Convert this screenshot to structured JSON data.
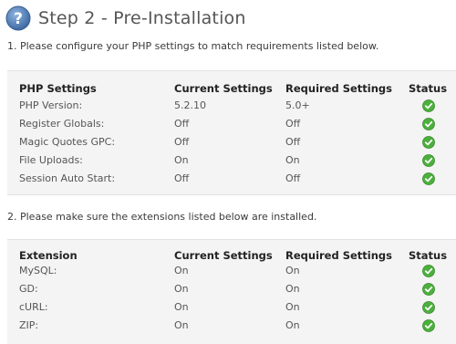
{
  "header": {
    "title": "Step 2 - Pre-Installation",
    "icon": "help-icon"
  },
  "php_section": {
    "instruction": "1. Please configure your PHP settings to match requirements listed below.",
    "columns": [
      "PHP Settings",
      "Current Settings",
      "Required Settings",
      "Status"
    ],
    "rows": [
      {
        "setting": "PHP Version:",
        "current": "5.2.10",
        "required": "5.0+",
        "status": "ok"
      },
      {
        "setting": "Register Globals:",
        "current": "Off",
        "required": "Off",
        "status": "ok"
      },
      {
        "setting": "Magic Quotes GPC:",
        "current": "Off",
        "required": "Off",
        "status": "ok"
      },
      {
        "setting": "File Uploads:",
        "current": "On",
        "required": "On",
        "status": "ok"
      },
      {
        "setting": "Session Auto Start:",
        "current": "Off",
        "required": "Off",
        "status": "ok"
      }
    ]
  },
  "ext_section": {
    "instruction": "2. Please make sure the extensions listed below are installed.",
    "columns": [
      "Extension",
      "Current Settings",
      "Required Settings",
      "Status"
    ],
    "rows": [
      {
        "setting": "MySQL:",
        "current": "On",
        "required": "On",
        "status": "ok"
      },
      {
        "setting": "GD:",
        "current": "On",
        "required": "On",
        "status": "ok"
      },
      {
        "setting": "cURL:",
        "current": "On",
        "required": "On",
        "status": "ok"
      },
      {
        "setting": "ZIP:",
        "current": "On",
        "required": "On",
        "status": "ok"
      }
    ]
  },
  "colors": {
    "help_icon": "#4f7fb8",
    "check_ok": "#4caf3e",
    "panel_bg": "#f4f4f4"
  }
}
